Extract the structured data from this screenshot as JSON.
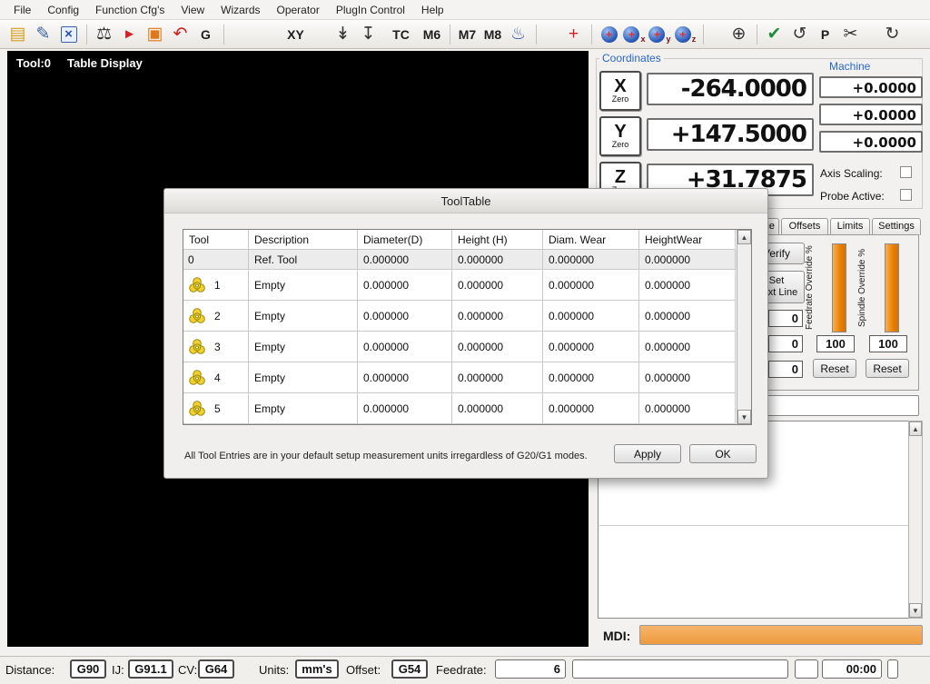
{
  "menu": {
    "items": [
      {
        "name": "menu-file",
        "label": "File"
      },
      {
        "name": "menu-config",
        "label": "Config"
      },
      {
        "name": "menu-function-cfgs",
        "label": "Function Cfg's"
      },
      {
        "name": "menu-view",
        "label": "View"
      },
      {
        "name": "menu-wizards",
        "label": "Wizards"
      },
      {
        "name": "menu-operator",
        "label": "Operator"
      },
      {
        "name": "menu-plugin-control",
        "label": "PlugIn Control"
      },
      {
        "name": "menu-help",
        "label": "Help"
      }
    ]
  },
  "toolbar": {
    "buttons": [
      {
        "name": "open-file-icon",
        "glyph": "▤",
        "cls": "c-gold big"
      },
      {
        "name": "edit-file-icon",
        "glyph": "✎",
        "cls": "c-blue big"
      },
      {
        "name": "close-file-icon",
        "glyph": "×",
        "cls": "tile-blue"
      },
      {
        "sep": true
      },
      {
        "name": "scales-icon",
        "glyph": "⚖",
        "cls": "c-dark big"
      },
      {
        "name": "jog-pointer-icon",
        "glyph": "►",
        "cls": "c-red"
      },
      {
        "name": "display-mode-icon",
        "glyph": "▣",
        "cls": "c-orange big"
      },
      {
        "name": "regen-icon",
        "glyph": "↶",
        "cls": "c-red big"
      },
      {
        "name": "gcode-button",
        "glyph": "G",
        "cls": "c-text"
      },
      {
        "sep": true
      },
      {
        "name": "xy-coords-button",
        "glyph": "XY",
        "cls": "c-text",
        "gap": 60
      },
      {
        "name": "lower-chevron-icon",
        "glyph": "↡",
        "cls": "c-dark big",
        "gap": 24
      },
      {
        "name": "lower-to-bar-icon",
        "glyph": "↧",
        "cls": "c-dark big"
      },
      {
        "name": "toolchange-button",
        "glyph": "TC",
        "cls": "c-text",
        "gap": 8
      },
      {
        "name": "m6-button",
        "glyph": "M6",
        "cls": "c-text",
        "gap": 6
      },
      {
        "sep": true
      },
      {
        "name": "m7-button",
        "glyph": "M7",
        "cls": "c-text"
      },
      {
        "name": "m8-button",
        "glyph": "M8",
        "cls": "c-text"
      },
      {
        "name": "coolant-icon",
        "glyph": "♨",
        "cls": "c-blue big"
      },
      {
        "sep": true
      },
      {
        "name": "ref-all-home-icon",
        "glyph": "+",
        "cls": "c-red big",
        "gap": 22
      },
      {
        "sep": true
      },
      {
        "name": "machine-coords-button",
        "glyph": "+",
        "cls": "orb",
        "sub": ""
      },
      {
        "name": "machine-coords-x-button",
        "glyph": "+",
        "cls": "orb",
        "sub": "x"
      },
      {
        "name": "machine-coords-y-button",
        "glyph": "+",
        "cls": "orb",
        "sub": "y"
      },
      {
        "name": "machine-coords-z-button",
        "glyph": "+",
        "cls": "orb",
        "sub": "z"
      },
      {
        "sep": true
      },
      {
        "name": "goto-zero-icon",
        "glyph": "⊕",
        "cls": "c-dark big",
        "gap": 20
      },
      {
        "sep": true
      },
      {
        "name": "shield-icon",
        "glyph": "✔",
        "cls": "c-green big"
      },
      {
        "name": "rotate-icon",
        "glyph": "↺",
        "cls": "c-dark big"
      },
      {
        "name": "p-button",
        "glyph": "P",
        "cls": "c-text"
      },
      {
        "name": "cut-icon",
        "glyph": "✂",
        "cls": "c-dark big"
      },
      {
        "name": "refresh-icon",
        "glyph": "↻",
        "cls": "c-dark big",
        "gap": 18
      }
    ]
  },
  "display": {
    "tool_label": "Tool:0",
    "mode_label": "Table Display"
  },
  "coordinates": {
    "title": "Coordinates",
    "machine_label": "Machine",
    "axes": [
      {
        "letter": "X",
        "zero_label": "Zero",
        "dro": "-264.0000",
        "machine_dro": "+0.0000"
      },
      {
        "letter": "Y",
        "zero_label": "Zero",
        "dro": "+147.5000",
        "machine_dro": "+0.0000"
      },
      {
        "letter": "Z",
        "zero_label": "Zero",
        "dro": "+31.7875",
        "machine_dro": "+0.0000"
      }
    ],
    "axis_scaling_label": "Axis Scaling:",
    "probe_active_label": "Probe Active:"
  },
  "tabs": [
    {
      "label": "ge"
    },
    {
      "label": "Offsets"
    },
    {
      "label": "Limits"
    },
    {
      "label": "Settings"
    }
  ],
  "controls": {
    "verify_label": "Verify",
    "set_next_line_1": "Set",
    "set_next_line_2": "Next Line",
    "feedrate_override_label": "Feedrate Override %",
    "spindle_override_label": "Spindle Override %",
    "feedrate_value": "100",
    "spindle_value": "100",
    "feedrate_reset_label": "Reset",
    "spindle_reset_label": "Reset",
    "zero1": "0",
    "zero2": "0",
    "zero3": "0"
  },
  "mdi": {
    "label": "MDI:"
  },
  "dialog": {
    "title": "ToolTable",
    "columns": [
      "Tool",
      "Description",
      "Diameter(D)",
      "Height (H)",
      "Diam. Wear",
      "HeightWear"
    ],
    "rows": [
      {
        "tool": "0",
        "icon": false,
        "description": "Ref. Tool",
        "diameter": "0.000000",
        "height": "0.000000",
        "diam_wear": "0.000000",
        "height_wear": "0.000000"
      },
      {
        "tool": "1",
        "icon": true,
        "description": "Empty",
        "diameter": "0.000000",
        "height": "0.000000",
        "diam_wear": "0.000000",
        "height_wear": "0.000000"
      },
      {
        "tool": "2",
        "icon": true,
        "description": "Empty",
        "diameter": "0.000000",
        "height": "0.000000",
        "diam_wear": "0.000000",
        "height_wear": "0.000000"
      },
      {
        "tool": "3",
        "icon": true,
        "description": "Empty",
        "diameter": "0.000000",
        "height": "0.000000",
        "diam_wear": "0.000000",
        "height_wear": "0.000000"
      },
      {
        "tool": "4",
        "icon": true,
        "description": "Empty",
        "diameter": "0.000000",
        "height": "0.000000",
        "diam_wear": "0.000000",
        "height_wear": "0.000000"
      },
      {
        "tool": "5",
        "icon": true,
        "description": "Empty",
        "diameter": "0.000000",
        "height": "0.000000",
        "diam_wear": "0.000000",
        "height_wear": "0.000000"
      }
    ],
    "footer_note": "All Tool Entries are in your default setup measurement units irregardless of G20/G1 modes.",
    "apply_label": "Apply",
    "ok_label": "OK"
  },
  "statusbar": {
    "distance_label": "Distance:",
    "distance_value": "G90",
    "ij_label": "IJ:",
    "ij_value": "G91.1",
    "cv_label": "CV:",
    "cv_value": "G64",
    "units_label": "Units:",
    "units_value": "mm's",
    "offset_label": "Offset:",
    "offset_value": "G54",
    "feedrate_label": "Feedrate:",
    "feedrate_value": "6",
    "timer_value": "00:00"
  },
  "icons": {
    "arrow_up": "▲",
    "arrow_down": "▼"
  },
  "colors": {
    "accent_orange": "#ee9a3e",
    "dro_bg": "#ffffff",
    "label_blue": "#2a66c8",
    "screen_black": "#000000"
  }
}
